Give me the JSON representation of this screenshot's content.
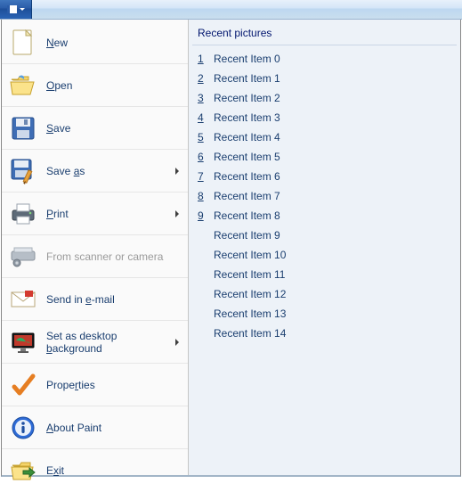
{
  "titlebar": {},
  "menu": {
    "items": [
      {
        "id": "new",
        "label": "New",
        "accel_index": 0,
        "icon": "doc-new",
        "submenu": false,
        "enabled": true
      },
      {
        "id": "open",
        "label": "Open",
        "accel_index": 0,
        "icon": "folder-open",
        "submenu": false,
        "enabled": true
      },
      {
        "id": "save",
        "label": "Save",
        "accel_index": 0,
        "icon": "floppy",
        "submenu": false,
        "enabled": true
      },
      {
        "id": "saveas",
        "label": "Save as",
        "accel_index": 5,
        "icon": "floppy-pencil",
        "submenu": true,
        "enabled": true
      },
      {
        "id": "print",
        "label": "Print",
        "accel_index": 0,
        "icon": "printer",
        "submenu": true,
        "enabled": true
      },
      {
        "id": "scan",
        "label": "From scanner or camera",
        "accel_index": -1,
        "icon": "scanner",
        "submenu": false,
        "enabled": false
      },
      {
        "id": "email",
        "label": "Send in e-mail",
        "accel_index": 8,
        "icon": "mail",
        "submenu": false,
        "enabled": true
      },
      {
        "id": "wall",
        "label": "Set as desktop background",
        "accel_index": 15,
        "icon": "monitor",
        "submenu": true,
        "enabled": true
      },
      {
        "id": "props",
        "label": "Properties",
        "accel_index": 5,
        "icon": "check",
        "submenu": false,
        "enabled": true
      },
      {
        "id": "about",
        "label": "About Paint",
        "accel_index": 0,
        "icon": "info",
        "submenu": false,
        "enabled": true
      },
      {
        "id": "exit",
        "label": "Exit",
        "accel_index": 1,
        "icon": "exit",
        "submenu": false,
        "enabled": true
      }
    ]
  },
  "recent": {
    "header": "Recent pictures",
    "items": [
      {
        "num": "1",
        "label": "Recent Item 0"
      },
      {
        "num": "2",
        "label": "Recent Item 1"
      },
      {
        "num": "3",
        "label": "Recent Item 2"
      },
      {
        "num": "4",
        "label": "Recent Item 3"
      },
      {
        "num": "5",
        "label": "Recent Item 4"
      },
      {
        "num": "6",
        "label": "Recent Item 5"
      },
      {
        "num": "7",
        "label": "Recent Item 6"
      },
      {
        "num": "8",
        "label": "Recent Item 7"
      },
      {
        "num": "9",
        "label": "Recent Item 8"
      },
      {
        "num": "",
        "label": "Recent Item 9"
      },
      {
        "num": "",
        "label": "Recent Item 10"
      },
      {
        "num": "",
        "label": "Recent Item 11"
      },
      {
        "num": "",
        "label": "Recent Item 12"
      },
      {
        "num": "",
        "label": "Recent Item 13"
      },
      {
        "num": "",
        "label": "Recent Item 14"
      }
    ]
  }
}
